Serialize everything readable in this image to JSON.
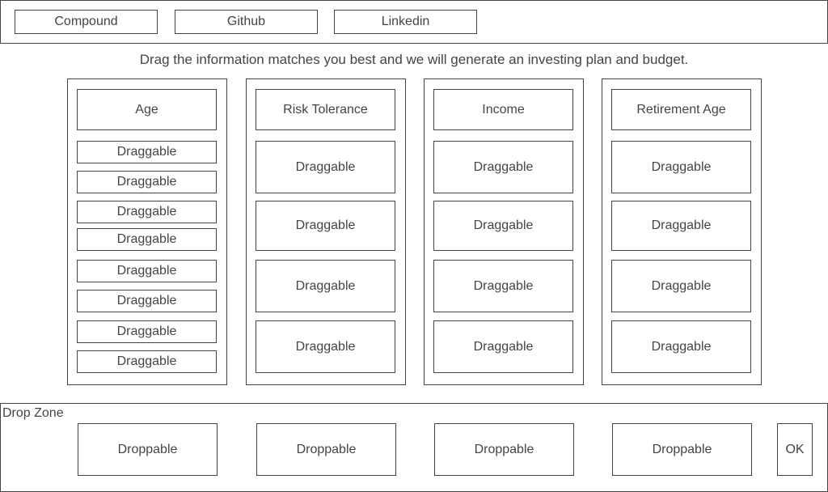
{
  "nav": {
    "buttons": [
      {
        "label": "Compound"
      },
      {
        "label": "Github"
      },
      {
        "label": "Linkedin"
      }
    ]
  },
  "instructions": "Drag the information matches you best and we will generate an investing plan and budget.",
  "columns": [
    {
      "header": "Age",
      "items": [
        "Draggable",
        "Draggable",
        "Draggable",
        "Draggable",
        "Draggable",
        "Draggable",
        "Draggable",
        "Draggable"
      ]
    },
    {
      "header": "Risk Tolerance",
      "items": [
        "Draggable",
        "Draggable",
        "Draggable",
        "Draggable"
      ]
    },
    {
      "header": "Income",
      "items": [
        "Draggable",
        "Draggable",
        "Draggable",
        "Draggable"
      ]
    },
    {
      "header": "Retirement Age",
      "items": [
        "Draggable",
        "Draggable",
        "Draggable",
        "Draggable"
      ]
    }
  ],
  "dropzone": {
    "label": "Drop Zone",
    "slots": [
      "Droppable",
      "Droppable",
      "Droppable",
      "Droppable"
    ],
    "ok_label": "OK"
  }
}
